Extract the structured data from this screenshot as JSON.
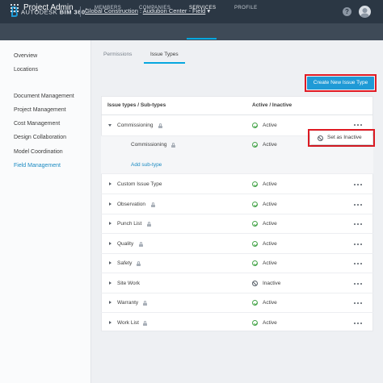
{
  "header": {
    "brand_prefix": "AUTODESK",
    "brand_product": "BIM 360",
    "brand_mark": "°",
    "project_parent": "Global Construction",
    "breadcrumb_separator": ":",
    "project_name": "Audubon Center - Field",
    "project_caret": "▾",
    "help_label": "?"
  },
  "navbar": {
    "app_title": "Project Admin",
    "tabs": [
      {
        "label": "MEMBERS",
        "active": false
      },
      {
        "label": "COMPANIES",
        "active": false
      },
      {
        "label": "SERVICES",
        "active": true
      },
      {
        "label": "PROFILE",
        "active": false
      }
    ]
  },
  "sidebar": {
    "items": [
      {
        "label": "Overview",
        "active": false
      },
      {
        "label": "Locations",
        "active": false
      },
      {
        "label": "Document Management",
        "active": false
      },
      {
        "label": "Project Management",
        "active": false
      },
      {
        "label": "Cost Management",
        "active": false
      },
      {
        "label": "Design Collaboration",
        "active": false
      },
      {
        "label": "Model Coordination",
        "active": false
      },
      {
        "label": "Field Management",
        "active": true
      }
    ]
  },
  "subtabs": [
    {
      "label": "Permissions",
      "active": false
    },
    {
      "label": "Issue Types",
      "active": true
    }
  ],
  "create_button": "Create New Issue Type",
  "table": {
    "col_type": "Issue types / Sub-types",
    "col_status": "Active / Inactive",
    "rows": [
      {
        "name": "Commissioning",
        "status": "Active",
        "expanded": true
      },
      {
        "name": "Commissioning",
        "status": "Active",
        "sub": true
      },
      {
        "name": "Custom Issue Type",
        "status": "Active"
      },
      {
        "name": "Observation",
        "status": "Active"
      },
      {
        "name": "Punch List",
        "status": "Active"
      },
      {
        "name": "Quality",
        "status": "Active"
      },
      {
        "name": "Safety",
        "status": "Active"
      },
      {
        "name": "Site Work",
        "status": "Inactive"
      },
      {
        "name": "Warranty",
        "status": "Active"
      },
      {
        "name": "Work List",
        "status": "Active"
      }
    ],
    "add_subtype": "Add sub-type"
  },
  "popup": {
    "label": "Set as Inactive"
  },
  "colors": {
    "accent": "#06a7df",
    "button": "#1f9ad6",
    "highlight": "#e01b24",
    "active_status": "#47a54b",
    "topbar": "#2b3744",
    "navbar": "#3e4a57"
  }
}
